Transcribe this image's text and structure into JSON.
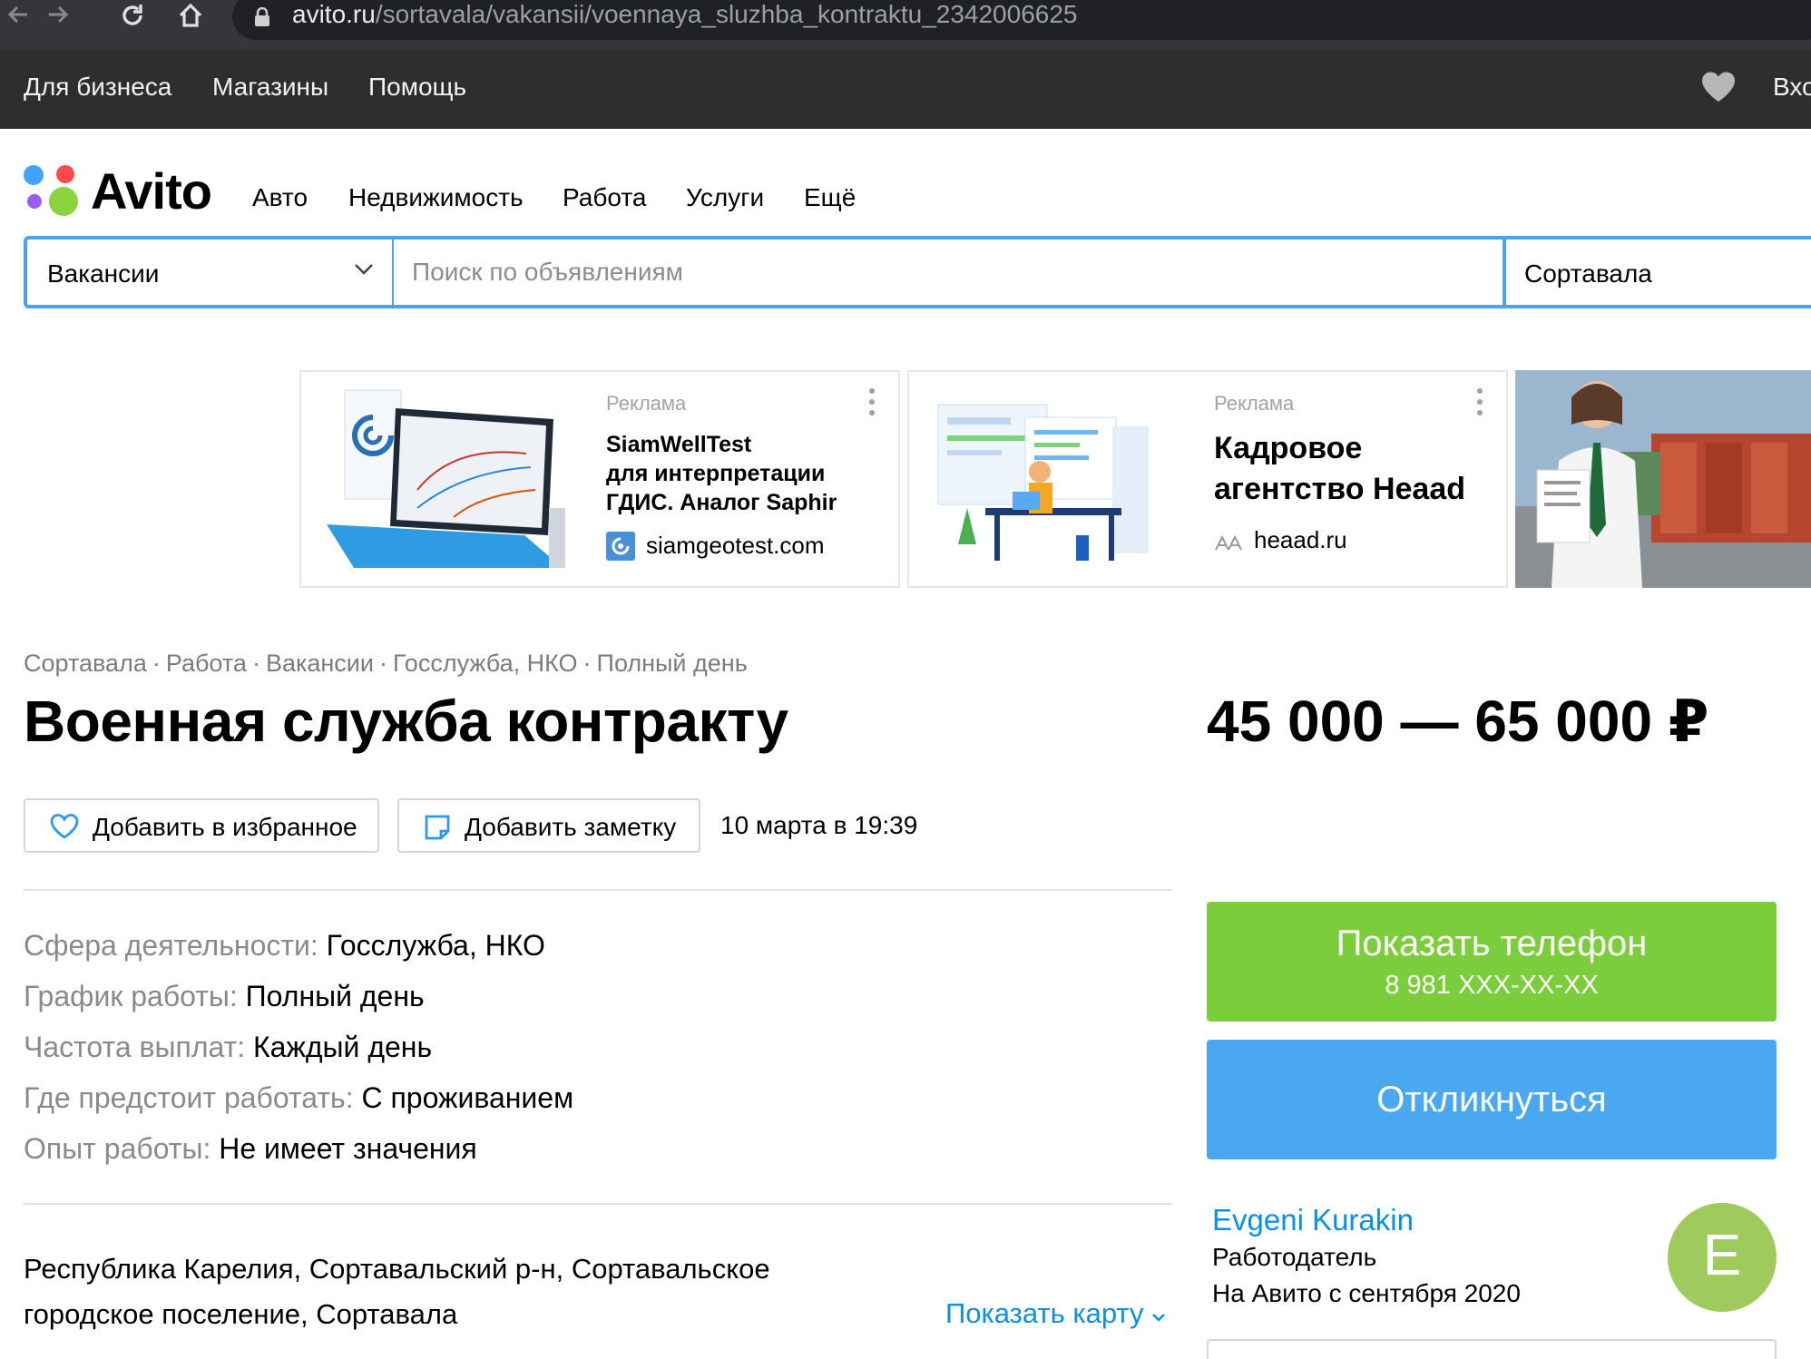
{
  "browser": {
    "url_host": "avito.ru",
    "url_path": "/sortavala/vakansii/voennaya_sluzhba_kontraktu_2342006625"
  },
  "top_menu": {
    "items": [
      "Для бизнеса",
      "Магазины",
      "Помощь"
    ],
    "login_label": "Вход"
  },
  "logo": {
    "text": "Avito"
  },
  "categories": [
    "Авто",
    "Недвижимость",
    "Работа",
    "Услуги",
    "Ещё"
  ],
  "search": {
    "category": "Вакансии",
    "placeholder": "Поиск по объявлениям",
    "location": "Сортавала"
  },
  "ads": [
    {
      "label": "Реклама",
      "title_lines": [
        "SiamWellTest",
        "для интерпретации",
        "ГДИС. Аналог Saphir"
      ],
      "domain": "siamgeotest.com"
    },
    {
      "label": "Реклама",
      "title_lines": [
        "Кадровое",
        "агентство Heaad"
      ],
      "domain": "heaad.ru"
    }
  ],
  "breadcrumbs": [
    "Сортавала",
    "Работа",
    "Вакансии",
    "Госслужба, НКО",
    "Полный день"
  ],
  "listing": {
    "title": "Военная служба контракту",
    "price": "45 000 — 65 000 ₽",
    "favorite_label": "Добавить в избранное",
    "note_label": "Добавить заметку",
    "date": "10 марта в 19:39",
    "params": [
      {
        "label": "Сфера деятельности:",
        "value": "Госслужба, НКО"
      },
      {
        "label": "График работы:",
        "value": "Полный день"
      },
      {
        "label": "Частота выплат:",
        "value": "Каждый день"
      },
      {
        "label": "Где предстоит работать:",
        "value": "С проживанием"
      },
      {
        "label": "Опыт работы:",
        "value": "Не имеет значения"
      }
    ],
    "address_line1": "Республика Карелия, Сортавальский р-н, Сортавальское",
    "address_line2": "городское поселение, Сортавала",
    "map_label": "Показать карту"
  },
  "contact": {
    "phone_label": "Показать телефон",
    "phone_masked": "8 981 XXX-XX-XX",
    "reply_label": "Откликнуться"
  },
  "seller": {
    "name": "Evgeni Kurakin",
    "role": "Работодатель",
    "since": "На Авито с сентября 2020",
    "avatar_letter": "E"
  },
  "colors": {
    "accent_blue": "#4aa3ec",
    "link_blue": "#0a8fe6",
    "phone_green": "#7ccd3c",
    "reply_blue": "#49a8ef",
    "avatar_green": "#9fcb5c"
  }
}
